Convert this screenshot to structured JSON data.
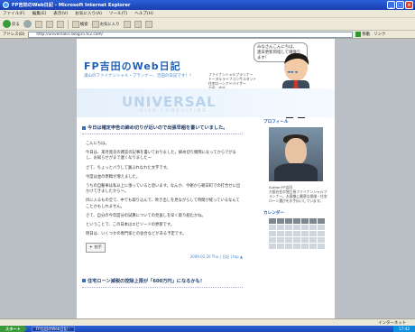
{
  "window": {
    "title": "FP吉田のWeb日記 - Microsoft Internet Explorer"
  },
  "menu": [
    "ファイル(F)",
    "編集(E)",
    "表示(V)",
    "お気に入り(A)",
    "ツール(T)",
    "ヘルプ(H)"
  ],
  "toolbar": {
    "back": "戻る",
    "search": "検索",
    "favorites": "お気に入り"
  },
  "address": {
    "label": "アドレス(D)",
    "value": "http://universalcc.blog15.fc2.com/",
    "go": "移動",
    "links": "リンク"
  },
  "header": {
    "title": "FP吉田のWeb日記",
    "subtitle": "湯山のファイナンシャル・プランナー、吉田の日記です！！",
    "speech": "みなさんこんにちは、\n連日更新目指して頑張ります！",
    "profile": [
      "ファイナンシャルプランナー",
      "トータルライフコンサルタント",
      "住宅ローンアドバイザー",
      "吉田　安志"
    ],
    "band_logo": "UNIVERSAL",
    "band_sub": "RISK CONSULTING",
    "nav": "◄◄ ◄"
  },
  "post1": {
    "title": "今日は確定申告の締め切りが近いので出張早稲を書いていました。",
    "paragraphs": [
      "こんにちは。",
      "今日は、来月発売の雑誌の記事を書いておりました。締め切り間際になってからでがまし、お知らせがまで遅くなりましたー",
      "さて、ちょっとバラして漏ぶれなれた文字です。",
      "今度は並の原稿が増えました。",
      "うちの自動車は私以上に張っていると思います。なんか、今朝から朝日町での打合せに出かけてきましたから～。",
      "目に入るもの全て、中でも取り込んで、吹き出しを見ながらして時間が経っているなんてことかもしれません。",
      "さて、自分の今年度分の試算についての見直しを早く取り組むかね。",
      "ということで、この日本はエピソードの更新です。",
      "明日は、いくつかの専門家との会合などがある予定です。"
    ],
    "clap": "拍手",
    "meta": "2009.02.20 Thu | 日記 | top ▲"
  },
  "post2": {
    "title": "住宅ローン減税の控除上限が「600万円」になるかも！"
  },
  "sidebar": {
    "profile_head": "プロフィール",
    "profile_text": "Author:FP吉田\n大阪在住の独立系ファイナンシャルプランナー。お客様に最適な保険・住宅ローン選びをお手伝いしています。",
    "calendar_head": "カレンダー"
  },
  "status": {
    "left": "",
    "zone": "インターネット"
  },
  "taskbar": {
    "start": "スタート",
    "task": "FP吉田のWeb日記 -",
    "clock": "17:42"
  }
}
